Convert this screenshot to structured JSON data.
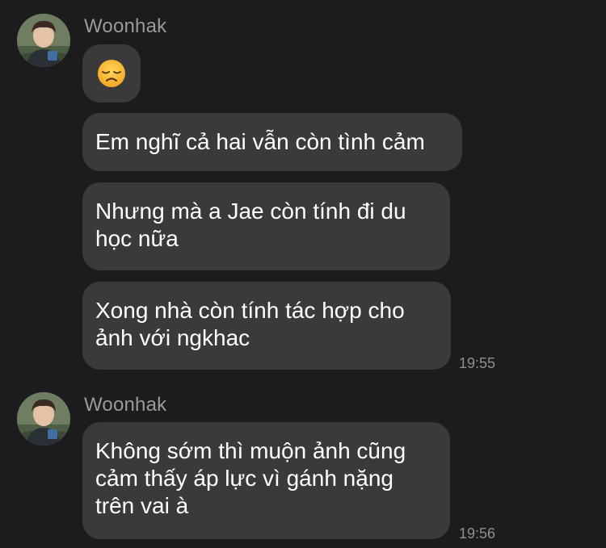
{
  "groups": [
    {
      "sender": "Woonhak",
      "emoji_message": {
        "emoji": "disappointed-face",
        "label": "😞"
      },
      "messages": [
        {
          "lines": [
            "Em nghĩ cả hai vẫn còn tình cảm"
          ]
        },
        {
          "lines": [
            "Nhưng mà a Jae còn tính đi du",
            "học nữa"
          ]
        },
        {
          "lines": [
            "Xong nhà còn tính tác hợp cho",
            "ảnh với ngkhac"
          ]
        }
      ],
      "time": "19:55"
    },
    {
      "sender": "Woonhak",
      "messages": [
        {
          "lines": [
            "Không sớm thì muộn ảnh cũng",
            "cảm thấy áp lực vì gánh nặng",
            "trên vai à"
          ]
        }
      ],
      "time": "19:56"
    }
  ],
  "colors": {
    "background": "#1c1c1e",
    "bubble": "#3a3a3c",
    "sender_name": "#9a9a9e",
    "timestamp": "#8e8e93"
  }
}
